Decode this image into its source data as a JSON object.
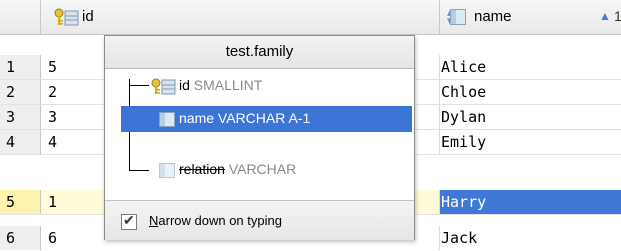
{
  "table": {
    "columns": [
      {
        "label": "id",
        "icon": "primary-key-column-icon",
        "sort": "unsorted"
      },
      {
        "label": "name",
        "icon": "column-icon",
        "sort": "ascending",
        "sort_order": "1"
      }
    ],
    "rows": [
      {
        "num": "1",
        "id": "5",
        "name": "Alice"
      },
      {
        "num": "2",
        "id": "2",
        "name": "Chloe"
      },
      {
        "num": "3",
        "id": "3",
        "name": "Dylan"
      },
      {
        "num": "4",
        "id": "4",
        "name": "Emily"
      },
      {
        "num": "5",
        "id": "1",
        "name": "Harry"
      },
      {
        "num": "6",
        "id": "6",
        "name": "Jack"
      }
    ],
    "highlighted_row": "5"
  },
  "popup": {
    "title": "test.family",
    "items": [
      {
        "name": "id",
        "type": "SMALLINT",
        "icon": "primary-key-column-icon"
      },
      {
        "name": "name VARCHAR A-1",
        "type": "",
        "icon": "column-icon",
        "selected": true
      },
      {
        "name": "relation",
        "type": "VARCHAR",
        "icon": "column-icon",
        "struck": true
      }
    ],
    "footer": {
      "checkbox_checked": true,
      "checkbox_label_mnemonic": "N",
      "checkbox_label_rest": "arrow down on typing"
    }
  },
  "colors": {
    "selection": "#3c75d6",
    "highlight_row": "#fffbd6"
  }
}
